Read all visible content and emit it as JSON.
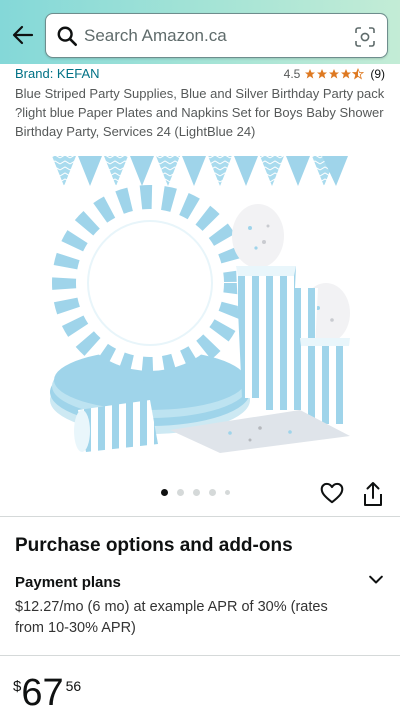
{
  "header": {
    "search_placeholder": "Search Amazon.ca",
    "icons": [
      "back-arrow-icon",
      "search-icon",
      "camera-scan-icon"
    ]
  },
  "product": {
    "brand": "Brand: KEFAN",
    "rating_value": "4.5",
    "rating_count": "(9)",
    "stars": 4.5,
    "title": "Blue Striped Party Supplies, Blue and Silver Birthday Party pack ?light blue Paper Plates and Napkins Set for Boys Baby Shower Birthday Party, Services 24 (LightBlue 24)"
  },
  "gallery": {
    "image_count": 5,
    "active_index": 0
  },
  "actions": [
    "heart-icon",
    "share-icon"
  ],
  "purchase": {
    "section_title": "Purchase options and add-ons",
    "plans_title": "Payment plans",
    "plans_text": "$12.27/mo (6 mo) at example APR of 30% (rates from 10-30% APR)"
  },
  "price": {
    "currency": "$",
    "whole": "67",
    "fraction": "56"
  },
  "colors": {
    "link": "#007185",
    "star": "#de7921",
    "header_gradient_start": "#84d8d8",
    "product_blue": "#9fd4ea"
  }
}
